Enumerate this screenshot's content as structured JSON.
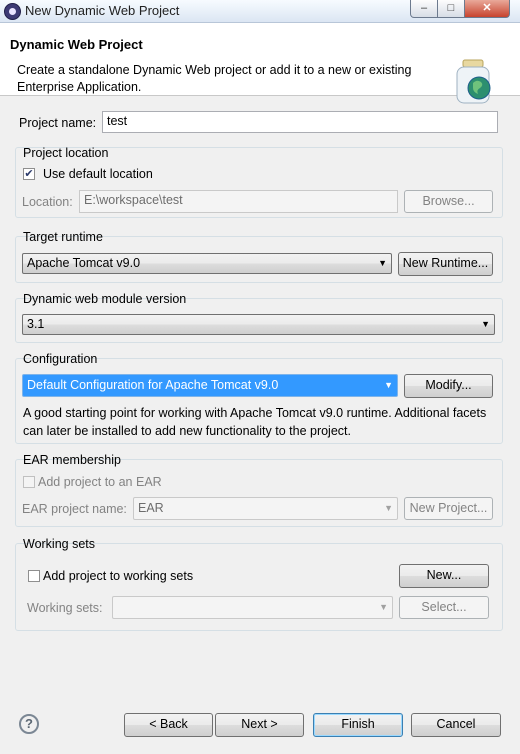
{
  "window": {
    "title": "New Dynamic Web Project"
  },
  "header": {
    "title": "Dynamic Web Project",
    "description": "Create a standalone Dynamic Web project or add it to a new or existing Enterprise Application."
  },
  "project_name": {
    "label": "Project name:",
    "value": "test"
  },
  "location": {
    "group_title": "Project location",
    "use_default_label": "Use default location",
    "use_default_checked": true,
    "location_label": "Location:",
    "location_value": "E:\\workspace\\test",
    "browse_label": "Browse..."
  },
  "target_runtime": {
    "group_title": "Target runtime",
    "selected": "Apache Tomcat v9.0",
    "new_runtime_label": "New Runtime..."
  },
  "module_version": {
    "group_title": "Dynamic web module version",
    "selected": "3.1"
  },
  "configuration": {
    "group_title": "Configuration",
    "selected": "Default Configuration for Apache Tomcat v9.0",
    "modify_label": "Modify...",
    "description": "A good starting point for working with Apache Tomcat v9.0 runtime. Additional facets can later be installed to add new functionality to the project."
  },
  "ear": {
    "group_title": "EAR membership",
    "add_label": "Add project to an EAR",
    "add_checked": false,
    "name_label": "EAR project name:",
    "name_value": "EAR",
    "new_project_label": "New Project..."
  },
  "working_sets": {
    "group_title": "Working sets",
    "add_label": "Add project to working sets",
    "add_checked": false,
    "new_label": "New...",
    "sets_label": "Working sets:",
    "sets_value": "",
    "select_label": "Select..."
  },
  "footer": {
    "back_label": "< Back",
    "next_label": "Next >",
    "finish_label": "Finish",
    "cancel_label": "Cancel"
  },
  "window_buttons": {
    "minimize": "–",
    "maximize": "□",
    "close": "✕"
  },
  "icons": {
    "help": "?"
  }
}
